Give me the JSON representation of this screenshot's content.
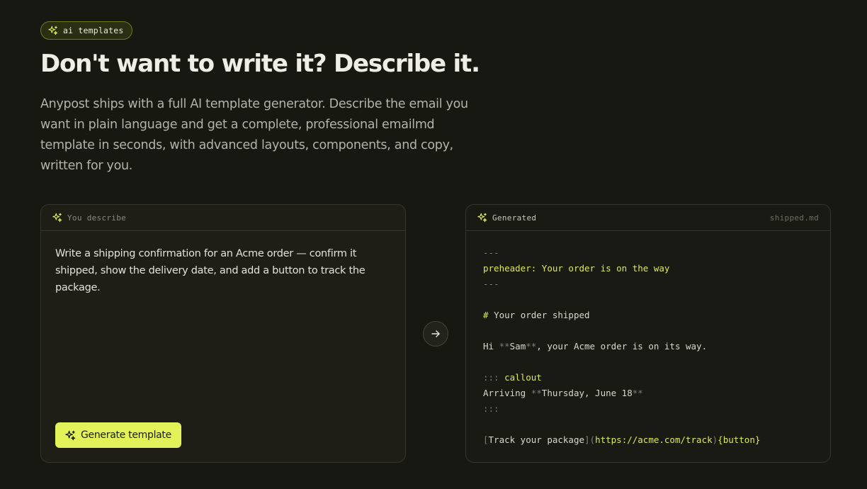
{
  "badge": {
    "label": "ai templates",
    "icon": "sparkles-icon"
  },
  "hero": {
    "title": "Don't want to write it? Describe it.",
    "lead": "Anypost ships with a full AI template generator. Describe the email you want in plain language and get a complete, professional emailmd template in seconds, with advanced layouts, components, and copy, written for you."
  },
  "describe_panel": {
    "header": "You describe",
    "prompt": "Write a shipping confirmation for an Acme order — confirm it shipped, show the delivery date, and add a button to track the package.",
    "button_label": "Generate template"
  },
  "generated_panel": {
    "header": "Generated",
    "filename": "shipped.md",
    "code": {
      "fm_open": "---",
      "preheader_key": "preheader:",
      "preheader_val": " Your order is on the way",
      "fm_close": "---",
      "h_mark": "# ",
      "h_text": "Your order shipped",
      "p_a": "Hi ",
      "p_b": "**",
      "p_c": "Sam",
      "p_d": "**",
      "p_e": ", your Acme order is on its way.",
      "c_open": "::: ",
      "c_name": "callout",
      "arr_a": "Arriving ",
      "arr_b": "**",
      "arr_c": "Thursday, June 18",
      "arr_d": "**",
      "c_close": ":::",
      "t_a": "[",
      "t_b": "Track your package",
      "t_c": "](",
      "t_d": "https://acme.com/track",
      "t_e": ")",
      "t_f": "{button}"
    }
  },
  "colors": {
    "background": "#181812",
    "accent": "#e4f25a",
    "panel": "#1e1e17"
  }
}
